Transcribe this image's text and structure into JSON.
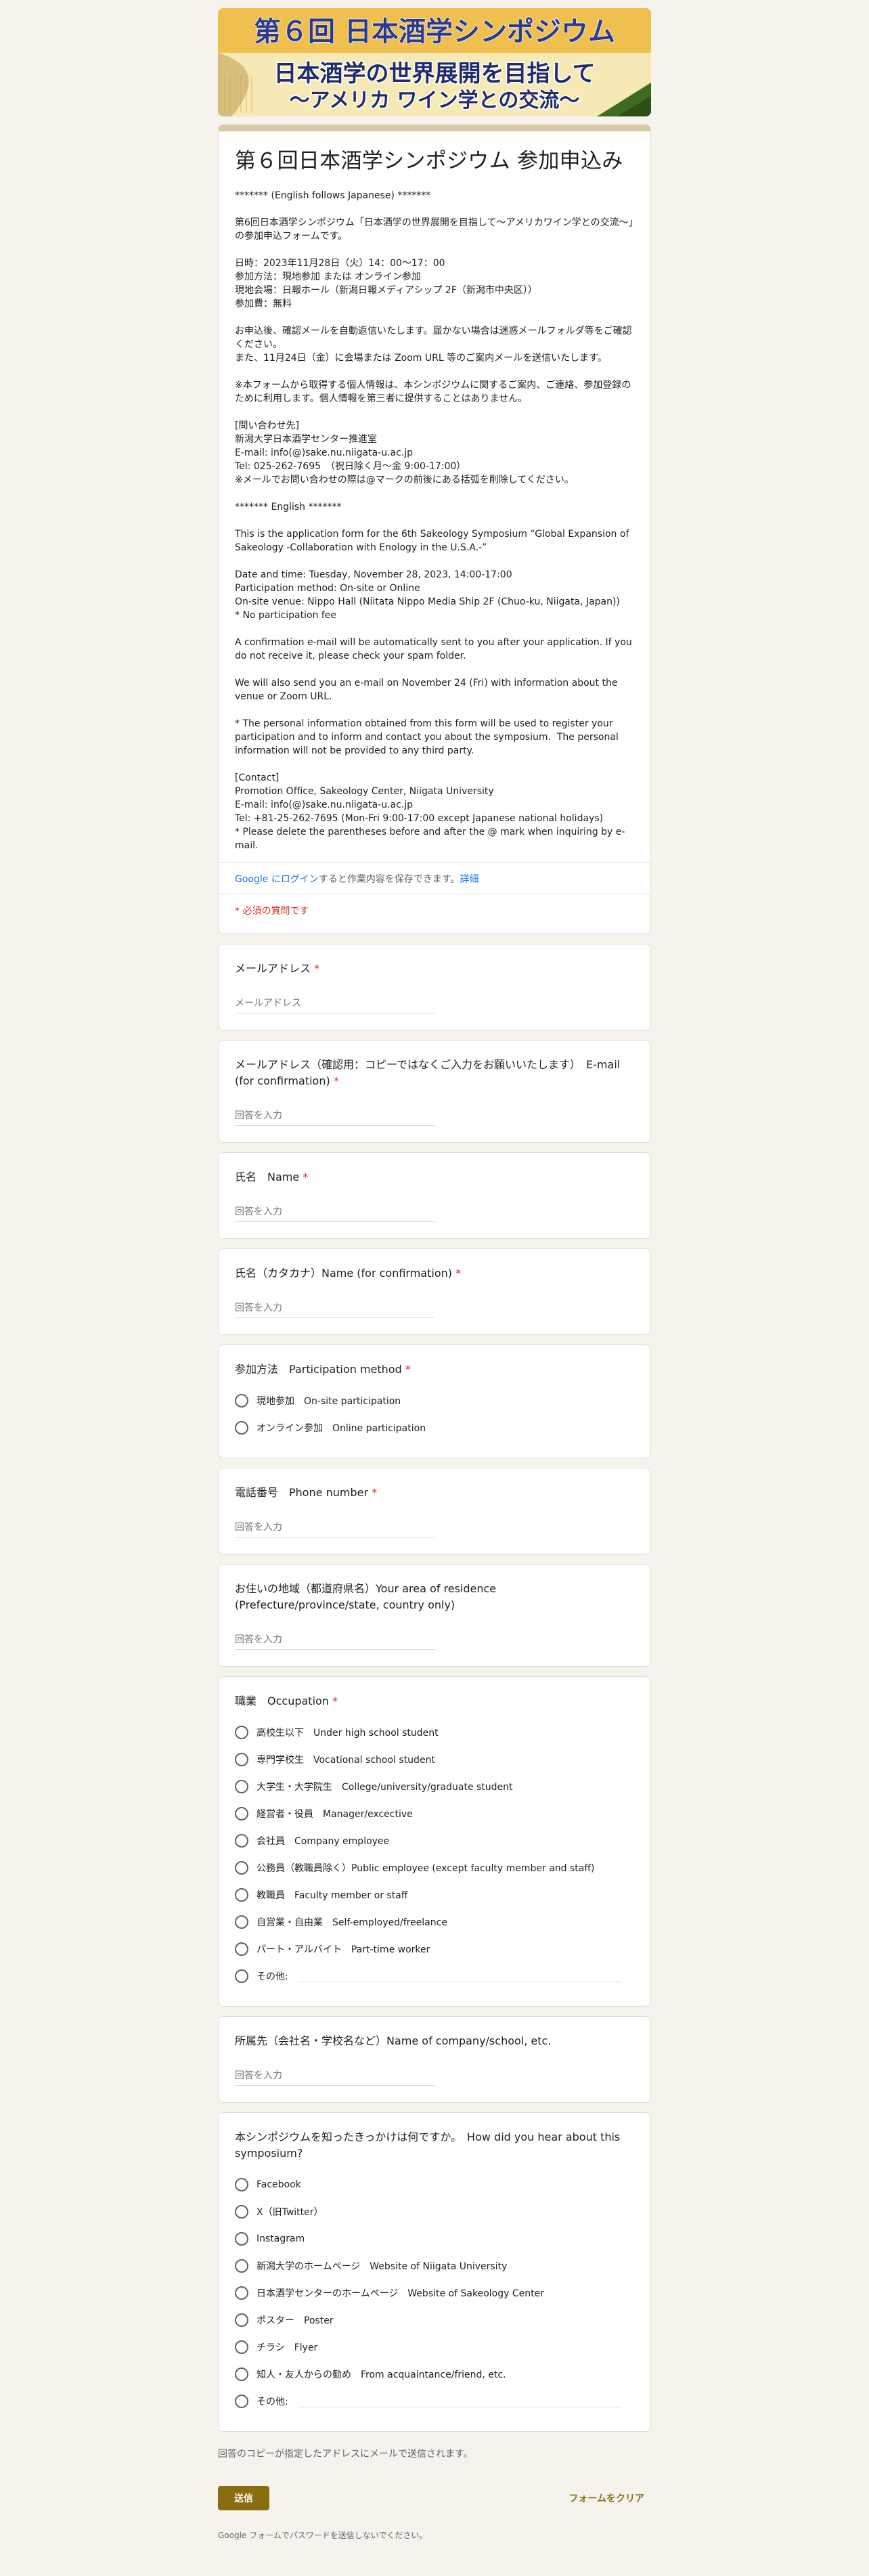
{
  "banner": {
    "title": "第６回 日本酒学シンポジウム",
    "subtitle_line1": "日本酒学の世界展開を目指して",
    "subtitle_line2": "～アメリカ ワイン学との交流～",
    "colors": {
      "gold": "#efc04f",
      "navy": "#1f2b6b",
      "green": "#3d6b1f",
      "cream": "#f7e9b5"
    }
  },
  "header": {
    "title": "第６回日本酒学シンポジウム 参加申込み",
    "description": "******* (English follows Japanese) *******\n\n第6回日本酒学シンポジウム「日本酒学の世界展開を目指して～アメリカワイン学との交流～」の参加申込フォームです。\n\n日時：2023年11月28日（火）14：00～17：00\n参加方法：現地参加 または オンライン参加\n現地会場：日報ホール（新潟日報メディアシップ 2F（新潟市中央区））\n参加費：無料\n\nお申込後、確認メールを自動返信いたします。届かない場合は迷惑メールフォルダ等をご確認ください。\nまた、11月24日（金）に会場または Zoom URL 等のご案内メールを送信いたします。\n\n※本フォームから取得する個人情報は、本シンポジウムに関するご案内、ご連絡、参加登録のために利用します。個人情報を第三者に提供することはありません。\n\n[問い合わせ先]\n新潟大学日本酒学センター推進室\nE-mail: info(@)sake.nu.niigata-u.ac.jp\nTel: 025-262-7695　（祝日除く月～金 9:00-17:00）\n※メールでお問い合わせの際は@マークの前後にある括弧を削除してください。\n\n******* English *******\n\nThis is the application form for the 6th Sakeology Symposium “Global Expansion of Sakeology -Collaboration with Enology in the U.S.A.-”\n\nDate and time: Tuesday, November 28, 2023, 14:00-17:00\nParticipation method: On-site or Online\nOn-site venue: Nippo Hall (Niitata Nippo Media Ship 2F (Chuo-ku, Niigata, Japan))\n* No participation fee\n\nA confirmation e-mail will be automatically sent to you after your application. If you do not receive it, please check your spam folder.\n\nWe will also send you an e-mail on November 24 (Fri) with information about the venue or Zoom URL.\n\n* The personal information obtained from this form will be used to register your participation and to inform and contact you about the symposium.  The personal information will not be provided to any third party.\n\n[Contact]\nPromotion Office, Sakeology Center, Niigata University\nE-mail: info(@)sake.nu.niigata-u.ac.jp\nTel: +81-25-262-7695 (Mon-Fri 9:00-17:00 except Japanese national holidays)\n* Please delete the parentheses before and after the @ mark when inquiring by e-mail.",
    "login_link": "Google にログイン",
    "login_text": "すると作業内容を保存できます。",
    "login_detail": "詳細",
    "required_note": "* 必須の質問です"
  },
  "questions": {
    "email": {
      "title": "メールアドレス",
      "required": "*",
      "placeholder": "メールアドレス"
    },
    "email_confirm": {
      "title": "メールアドレス（確認用：コピーではなくご入力をお願いいたします）　E-mail (for confirmation)",
      "required": "*",
      "placeholder": "回答を入力"
    },
    "name": {
      "title": "氏名　Name",
      "required": "*",
      "placeholder": "回答を入力"
    },
    "kana": {
      "title": "氏名（カタカナ）Name (for confirmation)",
      "required": "*",
      "placeholder": "回答を入力"
    },
    "method": {
      "title": "参加方法　Participation method",
      "required": "*",
      "options": [
        "現地参加　On-site participation",
        "オンライン参加　Online participation"
      ]
    },
    "phone": {
      "title": "電話番号　Phone number",
      "required": "*",
      "placeholder": "回答を入力"
    },
    "area": {
      "title": "お住いの地域（都道府県名）Your area of residence (Prefecture/province/state, country only)",
      "placeholder": "回答を入力"
    },
    "occupation": {
      "title": "職業　Occupation",
      "required": "*",
      "options": [
        "高校生以下　Under high school student",
        "専門学校生　Vocational school student",
        "大学生・大学院生　College/university/graduate student",
        "経営者・役員　Manager/excective",
        "会社員　Company employee",
        "公務員（教職員除く）Public employee (except faculty member and staff)",
        "教職員　Faculty member or staff",
        "自営業・自由業　Self-employed/freelance",
        "パート・アルバイト　Part-time worker"
      ],
      "other": "その他:"
    },
    "affiliation": {
      "title": "所属先（会社名・学校名など）Name of company/school, etc.",
      "placeholder": "回答を入力"
    },
    "source": {
      "title": "本シンポジウムを知ったきっかけは何ですか。　How did you hear about this symposium?",
      "options": [
        "Facebook",
        "X（旧Twitter）",
        "Instagram",
        "新潟大学のホームページ　Website of Niigata University",
        "日本酒学センターのホームページ　Website of Sakeology Center",
        "ポスター　Poster",
        "チラシ　Flyer",
        "知人・友人からの勧め　From acquaintance/friend, etc."
      ],
      "other": "その他:"
    }
  },
  "footer": {
    "copy_note": "回答のコピーが指定したアドレスにメールで送信されます。",
    "submit": "送信",
    "clear": "フォームをクリア",
    "password_note": "Google フォームでパスワードを送信しないでください。"
  }
}
